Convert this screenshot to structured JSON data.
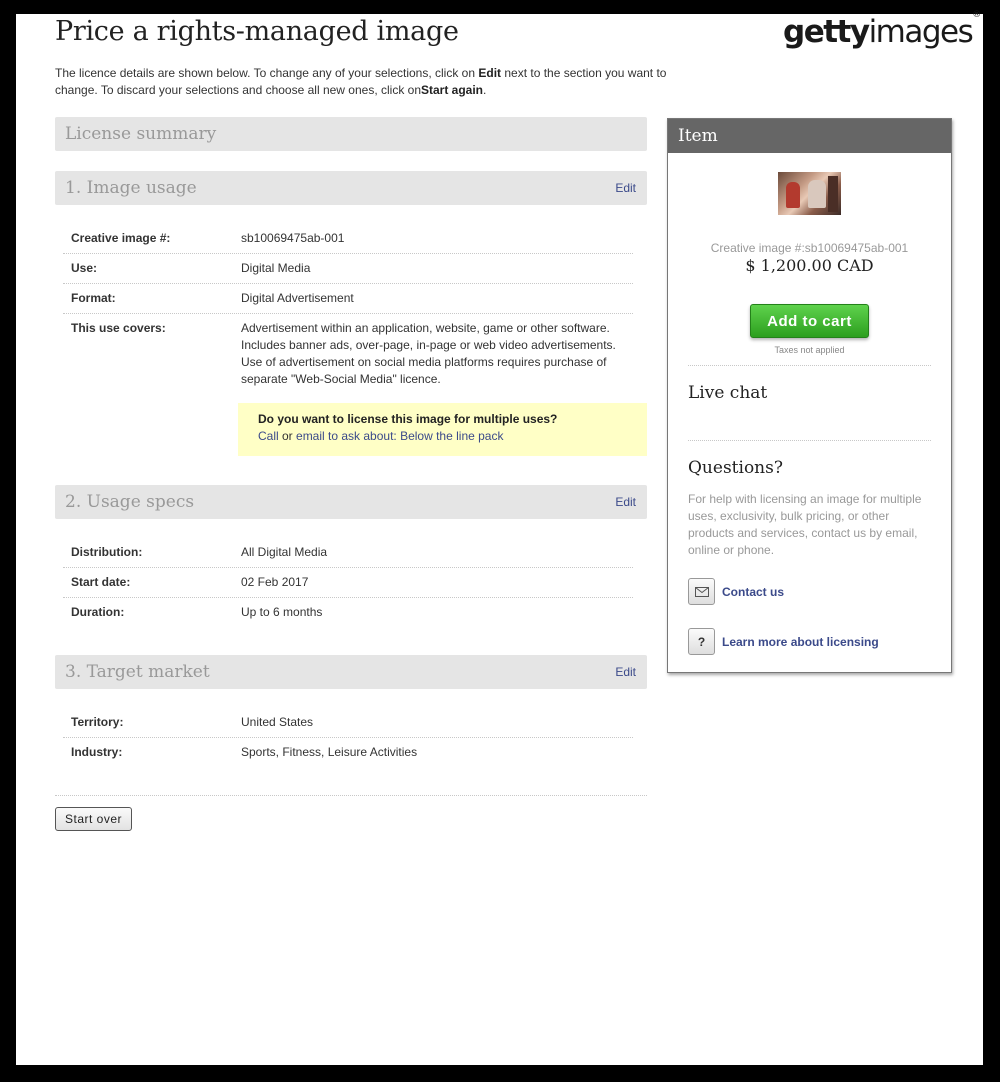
{
  "header": {
    "title": "Price a rights-managed image",
    "logo_light": "getty",
    "logo_bold": "images",
    "logo_mark": "®"
  },
  "intro": {
    "part1": "The licence details are shown below. To change any of your selections, click on ",
    "edit_word": "Edit",
    "part2": " next to the section you want to change. To discard your selections and choose all new ones, click on",
    "start_word": "Start again",
    "part3": "."
  },
  "summary_title": "License summary",
  "edit_label": "Edit",
  "sections": {
    "image_usage": {
      "title": "1. Image usage",
      "rows": [
        {
          "label": "Creative image #:",
          "value": "sb10069475ab-001"
        },
        {
          "label": "Use:",
          "value": "Digital Media"
        },
        {
          "label": "Format:",
          "value": "Digital Advertisement"
        },
        {
          "label": "This use covers:",
          "value_lines": [
            "Advertisement within an application, website, game or other software.",
            "Includes banner ads, over-page, in-page or web video advertisements.",
            "Use of advertisement on social media platforms requires purchase of",
            "separate \"Web-Social Media\" licence."
          ]
        }
      ],
      "notice": {
        "question": "Do you want to license this image for multiple uses?",
        "call": "Call",
        "or": " or ",
        "email": "email",
        "rest": " to ask about: Below the line pack"
      }
    },
    "usage_specs": {
      "title": "2. Usage specs",
      "rows": [
        {
          "label": "Distribution:",
          "value": "All Digital Media"
        },
        {
          "label": "Start date:",
          "value": "02 Feb 2017"
        },
        {
          "label": "Duration:",
          "value": "Up to 6 months"
        }
      ]
    },
    "target_market": {
      "title": "3. Target market",
      "rows": [
        {
          "label": "Territory:",
          "value": "United States"
        },
        {
          "label": "Industry:",
          "value": "Sports, Fitness, Leisure Activities"
        }
      ]
    }
  },
  "start_over_label": "Start over",
  "sidebar": {
    "title": "Item",
    "image_id": "Creative image #:sb10069475ab-001",
    "price": "$ 1,200.00 CAD",
    "add_to_cart": "Add to cart",
    "tax_note": "Taxes not applied",
    "live_chat": "Live chat",
    "questions": "Questions?",
    "help_text": "For help with licensing an image for multiple uses, exclusivity, bulk pricing, or other products and services, contact us by email, online or phone.",
    "contact_label": "Contact us",
    "learn_label": "Learn more about licensing",
    "question_glyph": "?"
  }
}
